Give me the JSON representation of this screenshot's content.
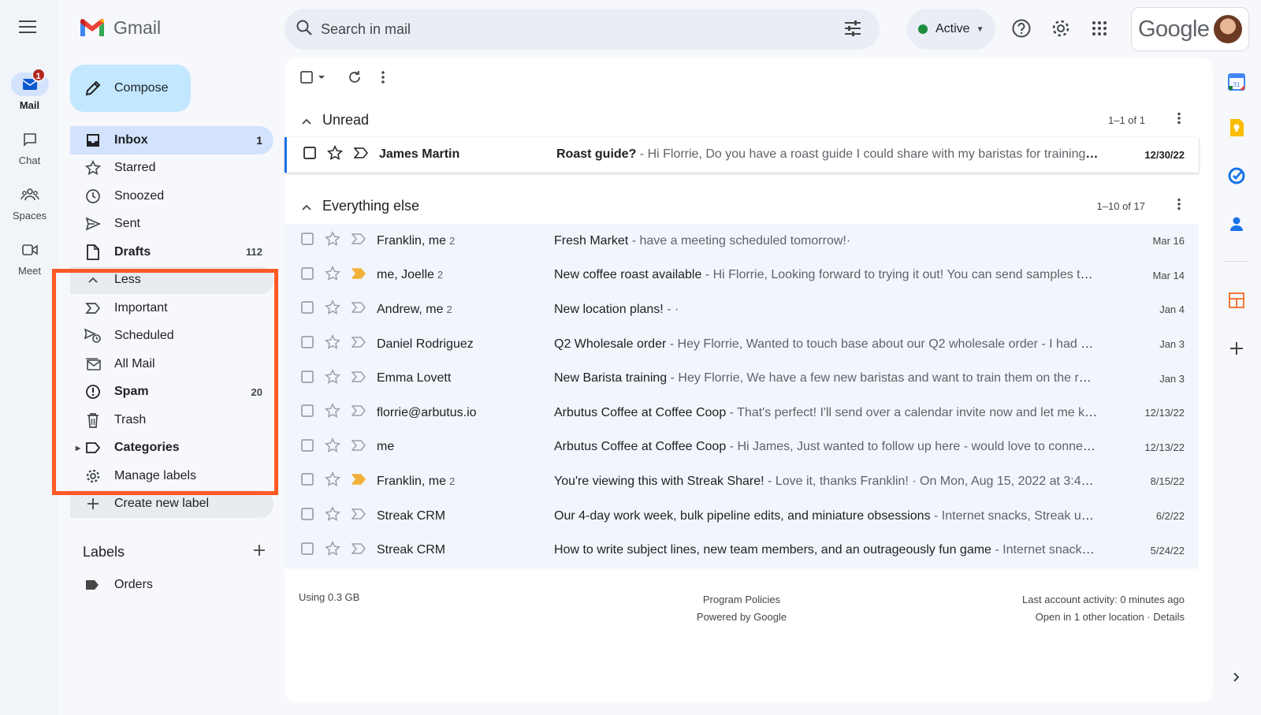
{
  "app": {
    "name": "Gmail"
  },
  "rail": [
    {
      "label": "Mail",
      "badge": "1",
      "active": true
    },
    {
      "label": "Chat"
    },
    {
      "label": "Spaces"
    },
    {
      "label": "Meet"
    }
  ],
  "search": {
    "placeholder": "Search in mail"
  },
  "status": {
    "label": "Active"
  },
  "account": {
    "brand": "Google"
  },
  "compose": {
    "label": "Compose"
  },
  "nav": {
    "inbox": {
      "label": "Inbox",
      "count": "1"
    },
    "starred": {
      "label": "Starred"
    },
    "snoozed": {
      "label": "Snoozed"
    },
    "sent": {
      "label": "Sent"
    },
    "drafts": {
      "label": "Drafts",
      "count": "112"
    },
    "less": {
      "label": "Less"
    },
    "important": {
      "label": "Important"
    },
    "scheduled": {
      "label": "Scheduled"
    },
    "allmail": {
      "label": "All Mail"
    },
    "spam": {
      "label": "Spam",
      "count": "20"
    },
    "trash": {
      "label": "Trash"
    },
    "categories": {
      "label": "Categories"
    },
    "manage": {
      "label": "Manage labels"
    },
    "create": {
      "label": "Create new label"
    }
  },
  "labels": {
    "title": "Labels",
    "items": [
      {
        "name": "Orders"
      }
    ]
  },
  "sections": {
    "unread": {
      "title": "Unread",
      "range": "1–1 of 1"
    },
    "everything": {
      "title": "Everything else",
      "range": "1–10 of 17"
    }
  },
  "unread_rows": [
    {
      "sender": "James Martin",
      "count": "",
      "subject": "Roast guide?",
      "snippet": " - Hi Florrie, Do you have a roast guide I could share with my baristas for training? T...",
      "date": "12/30/22"
    }
  ],
  "rows": [
    {
      "sender": "Franklin, me",
      "count": "2",
      "subject": "Fresh Market",
      "snippet": " - have a meeting scheduled tomorrow!·",
      "date": "Mar 16",
      "important": false
    },
    {
      "sender": "me, Joelle",
      "count": "2",
      "subject": "New coffee roast available",
      "snippet": " - Hi Florrie, Looking forward to trying it out! You can send samples to: ...",
      "date": "Mar 14",
      "important": true
    },
    {
      "sender": "Andrew, me",
      "count": "2",
      "subject": "New location plans!",
      "snippet": " - ·",
      "date": "Jan 4",
      "important": false
    },
    {
      "sender": "Daniel Rodriguez",
      "count": "",
      "subject": "Q2 Wholesale order",
      "snippet": " - Hey Florrie, Wanted to touch base about our Q2 wholesale order - I had a c...",
      "date": "Jan 3",
      "important": false
    },
    {
      "sender": "Emma Lovett",
      "count": "",
      "subject": "New Barista training",
      "snippet": " - Hey Florrie, We have a few new baristas and want to train them on the roas...",
      "date": "Jan 3",
      "important": false
    },
    {
      "sender": "florrie@arbutus.io",
      "count": "",
      "subject": "Arbutus Coffee at Coffee Coop",
      "snippet": " - That's perfect! I'll send over a calendar invite now and let me kn...",
      "date": "12/13/22",
      "important": false
    },
    {
      "sender": "me",
      "count": "",
      "subject": "Arbutus Coffee at Coffee Coop",
      "snippet": " - Hi James, Just wanted to follow up here - would love to connect ...",
      "date": "12/13/22",
      "important": false
    },
    {
      "sender": "Franklin, me",
      "count": "2",
      "subject": "You're viewing this with Streak Share!",
      "snippet": " - Love it, thanks Franklin! · On Mon, Aug 15, 2022 at 3:47 PM ...",
      "date": "8/15/22",
      "important": true
    },
    {
      "sender": "Streak CRM",
      "count": "",
      "subject": "Our 4-day work week, bulk pipeline edits, and miniature obsessions",
      "snippet": " - Internet snacks, Streak upd...",
      "date": "6/2/22",
      "important": false
    },
    {
      "sender": "Streak CRM",
      "count": "",
      "subject": "How to write subject lines, new team members, and an outrageously fun game",
      "snippet": " - Internet snacks, ...",
      "date": "5/24/22",
      "important": false
    }
  ],
  "footer": {
    "storage": "Using 0.3 GB",
    "policies": "Program Policies",
    "powered": "Powered by Google",
    "activity": "Last account activity: 0 minutes ago",
    "other": "Open in 1 other location · Details"
  },
  "colors": {
    "highlight": "#ff5a25",
    "accent": "#1a73e8",
    "compose_bg": "#c2e7ff",
    "active_nav": "#d3e3fd",
    "important_marker": "#f2b13b"
  }
}
